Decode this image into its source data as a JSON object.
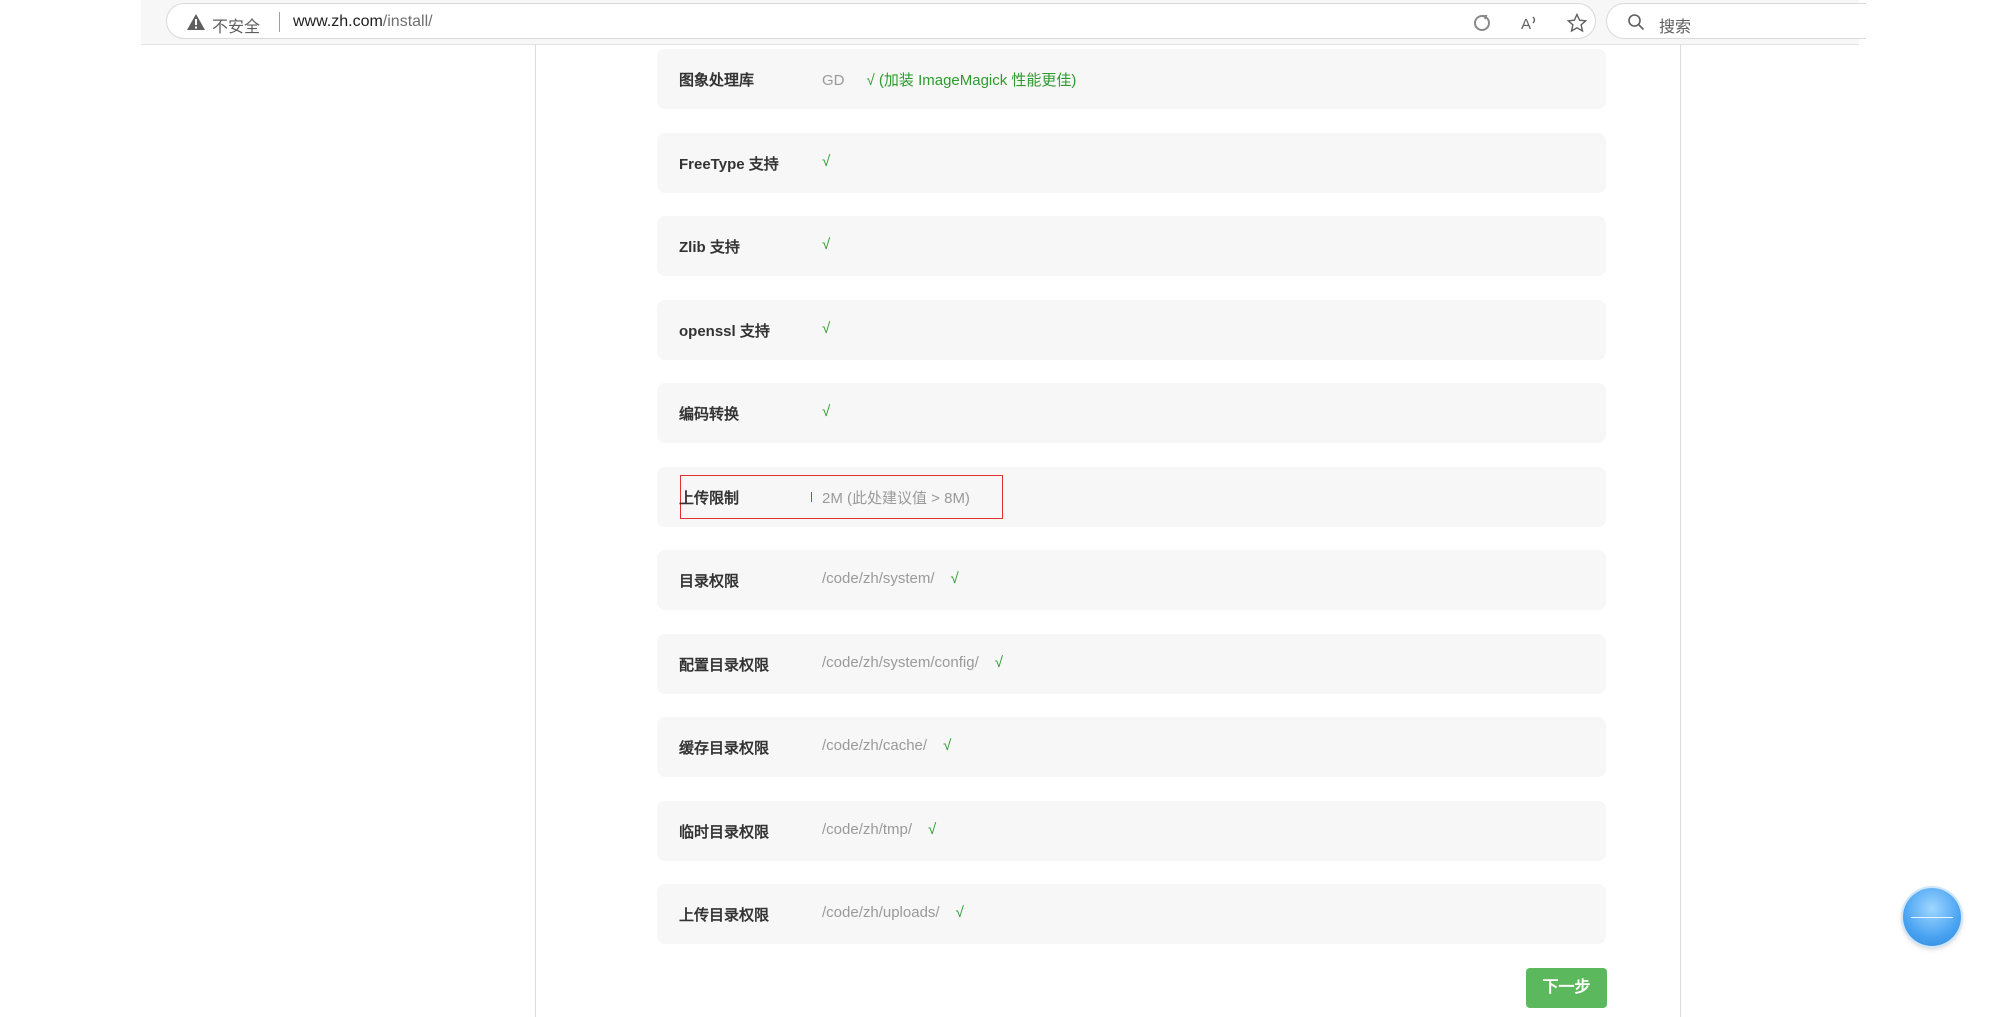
{
  "browser": {
    "security_label": "不安全",
    "url_host": "www.zh.com",
    "url_path": "/install/",
    "search_label": "搜索"
  },
  "checks": [
    {
      "label": "图象处理库",
      "value": "GD",
      "status": "√ (加装 ImageMagick 性能更佳)"
    },
    {
      "label": "FreeType 支持",
      "value": "",
      "status": "√"
    },
    {
      "label": "Zlib 支持",
      "value": "",
      "status": "√"
    },
    {
      "label": "openssl 支持",
      "value": "",
      "status": "√"
    },
    {
      "label": "编码转换",
      "value": "",
      "status": "√"
    },
    {
      "label": "上传限制",
      "value": "2M (此处建议值 > 8M)",
      "status": ""
    },
    {
      "label": "目录权限",
      "value": "/code/zh/system/",
      "status": "√"
    },
    {
      "label": "配置目录权限",
      "value": "/code/zh/system/config/",
      "status": "√"
    },
    {
      "label": "缓存目录权限",
      "value": "/code/zh/cache/",
      "status": "√"
    },
    {
      "label": "临时目录权限",
      "value": "/code/zh/tmp/",
      "status": "√"
    },
    {
      "label": "上传目录权限",
      "value": "/code/zh/uploads/",
      "status": "√"
    }
  ],
  "next_button": "下一步",
  "colors": {
    "ok_green": "#2e9a2e",
    "button_green": "#5cb85c",
    "highlight_red": "#e03030",
    "row_bg": "#f7f7f7"
  }
}
